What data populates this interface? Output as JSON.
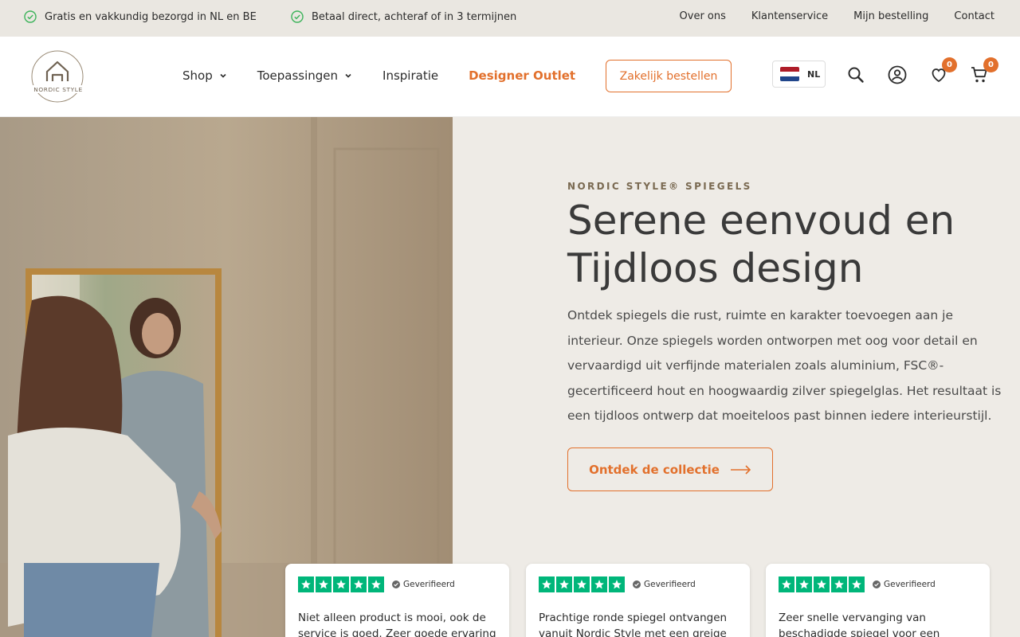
{
  "topbar": {
    "usps": [
      "Gratis en vakkundig bezorgd in NL en BE",
      "Betaal direct, achteraf of in 3 termijnen"
    ],
    "links": [
      "Over ons",
      "Klantenservice",
      "Mijn bestelling",
      "Contact"
    ]
  },
  "header": {
    "nav": {
      "shop": "Shop",
      "toepassingen": "Toepassingen",
      "inspiratie": "Inspiratie",
      "outlet": "Designer Outlet"
    },
    "business_button": "Zakelijk bestellen",
    "language": "NL",
    "wishlist_count": "0",
    "cart_count": "0"
  },
  "hero": {
    "eyebrow": "NORDIC STYLE® SPIEGELS",
    "headline_line1": "Serene eenvoud en",
    "headline_line2": "Tijdloos design",
    "lead": "Ontdek spiegels die rust, ruimte en karakter toevoegen aan je interieur. Onze spiegels worden ontworpen met oog voor detail en vervaardigd uit verfijnde materialen zoals aluminium, FSC®-gecertificeerd hout en hoogwaardig zilver spiegelglas. Het resultaat is een tijdloos ontwerp dat moeiteloos past binnen iedere interieurstijl.",
    "cta": "Ontdek de collectie"
  },
  "reviews": [
    {
      "verified": "Geverifieerd",
      "text": "Niet alleen product is mooi, ook de service is goed. Zeer goede ervaring"
    },
    {
      "verified": "Geverifieerd",
      "text": "Prachtige ronde spiegel ontvangen vanuit Nordic Style met een greige"
    },
    {
      "verified": "Geverifieerd",
      "text": "Zeer snelle vervanging van beschadigde spiegel voor een"
    }
  ],
  "colors": {
    "accent": "#e2702c",
    "topbar_bg": "#eae7e1",
    "hero_bg": "#eeebe6",
    "trustpilot_green": "#00b67a",
    "check_green": "#3cb35a"
  }
}
